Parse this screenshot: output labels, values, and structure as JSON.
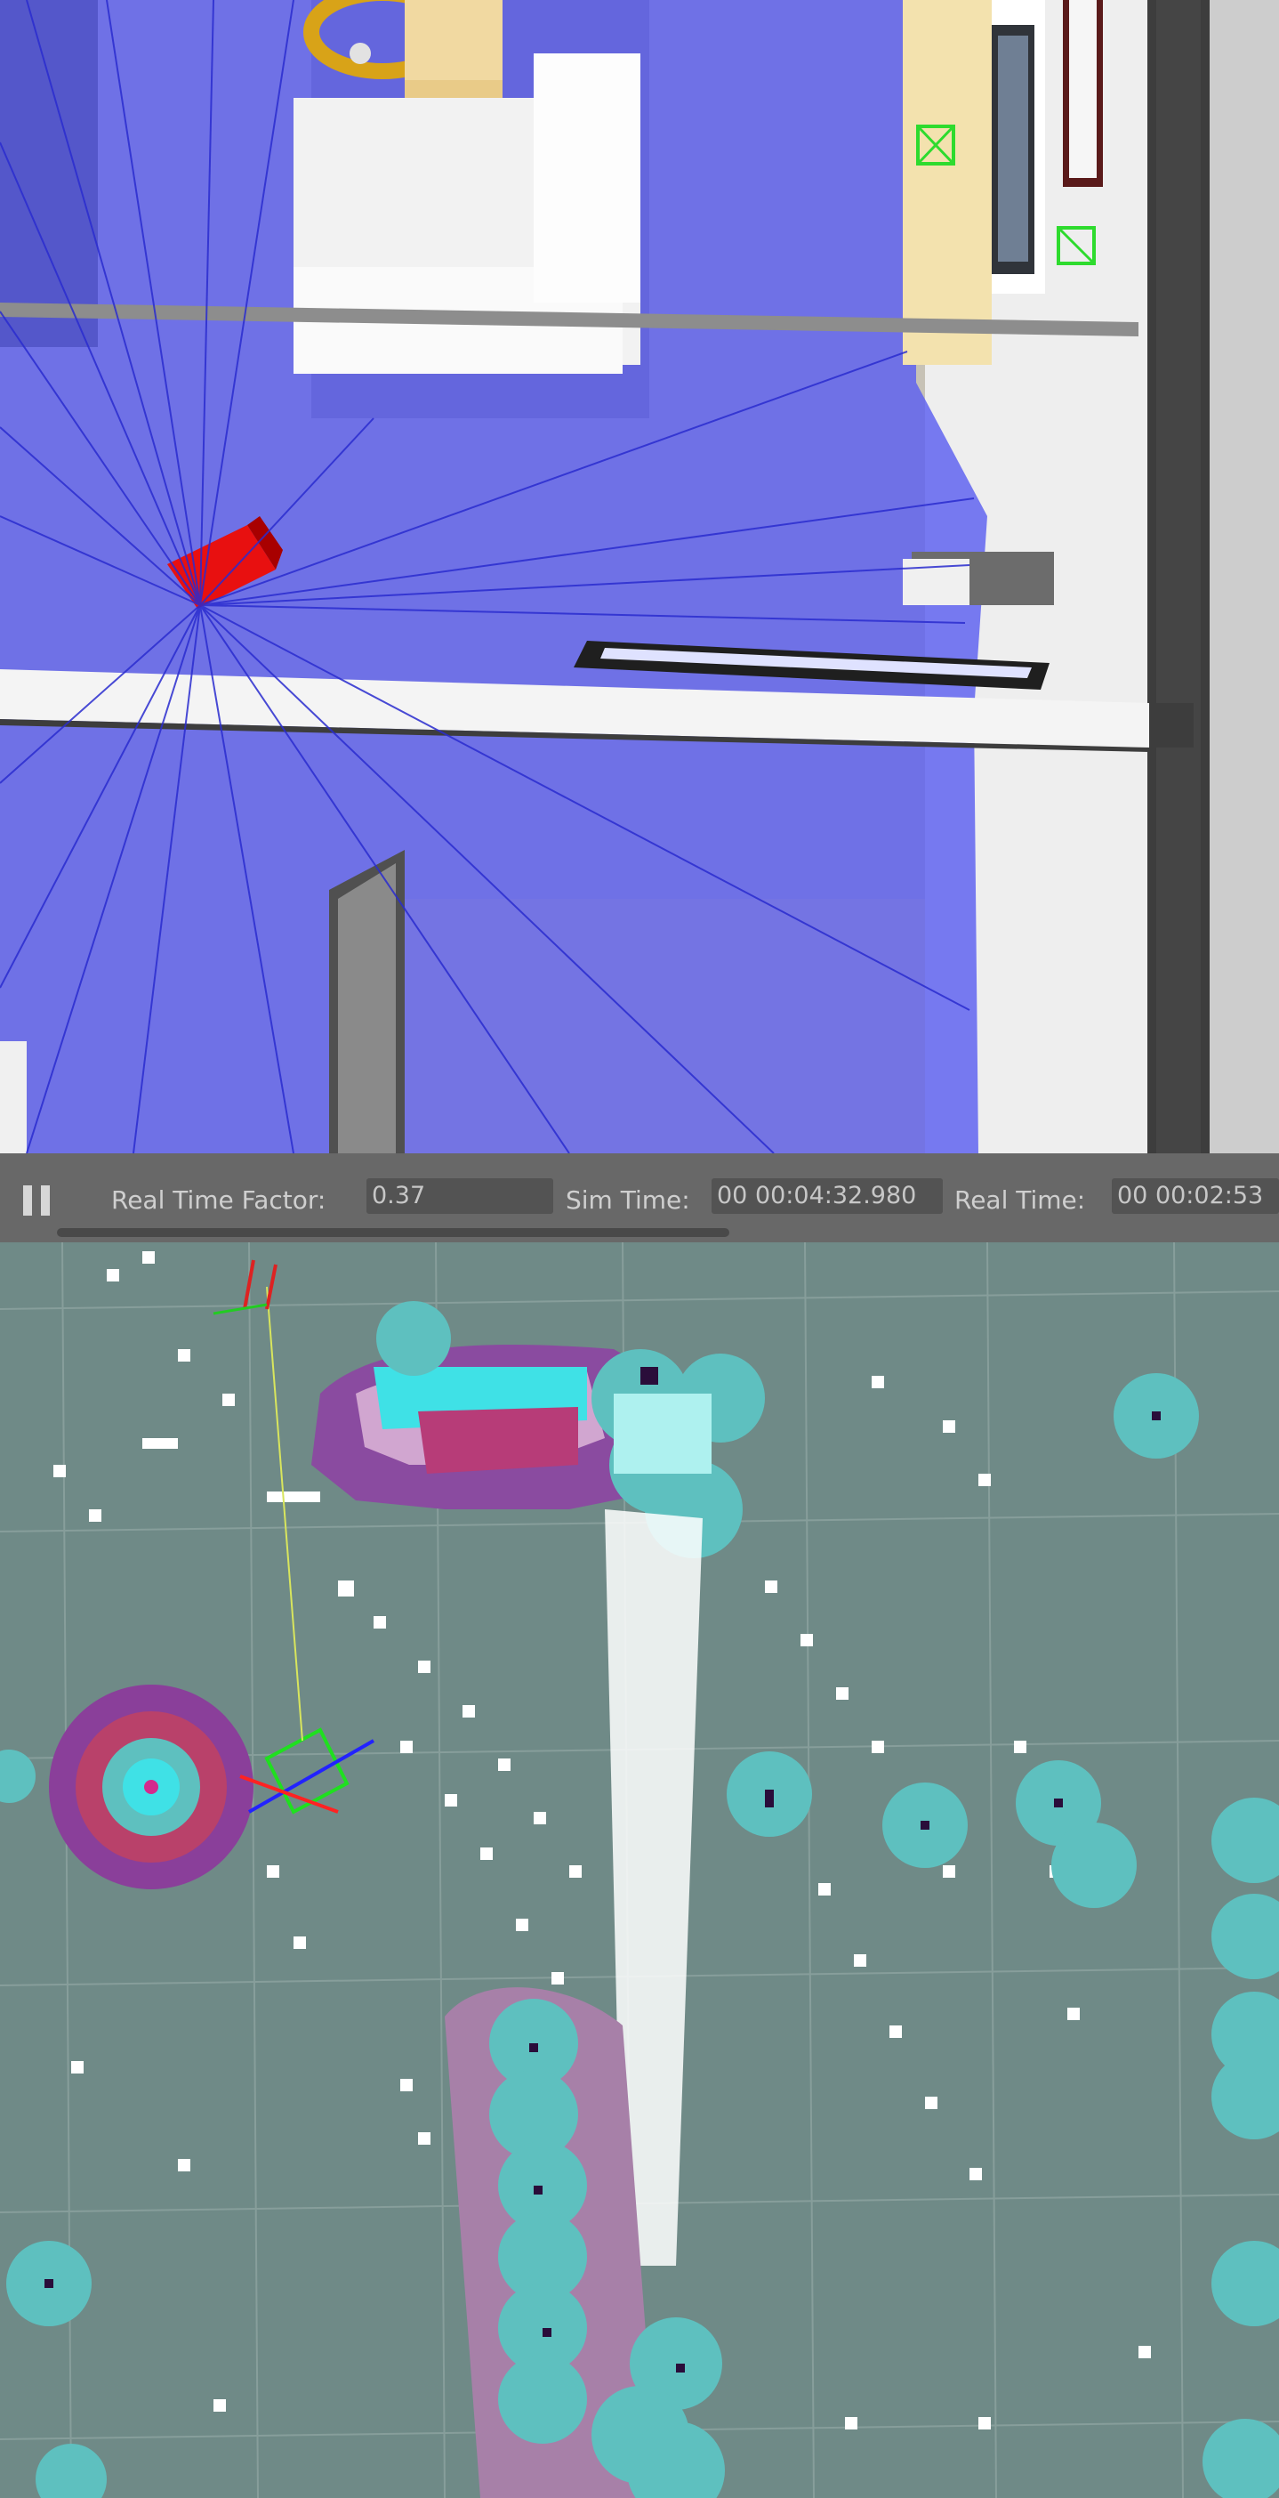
{
  "simulator": {
    "status_bar": {
      "real_time_factor_label": "Real Time Factor:",
      "real_time_factor_value": "0.37",
      "sim_time_label": "Sim Time:",
      "sim_time_value": "00 00:04:32.980",
      "real_time_label": "Real Time:",
      "real_time_value": "00 00:02:53",
      "pause_icon": "pause-icon"
    }
  },
  "costmap": {
    "background_color": "#6f8a87",
    "inflation_color": "#5ec0bf",
    "lethal_color": "#e6ffff",
    "laser_hit_color": "#ffffff"
  }
}
